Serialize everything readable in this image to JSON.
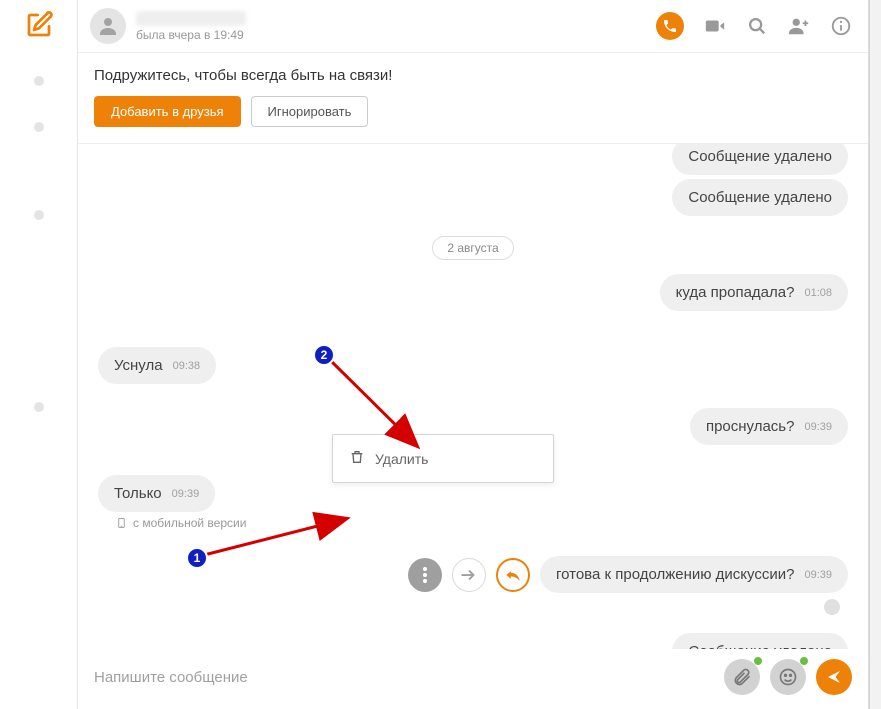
{
  "header": {
    "last_seen": "была вчера в 19:49"
  },
  "friend_bar": {
    "text": "Подружитесь, чтобы всегда быть на связи!",
    "add_friend": "Добавить в друзья",
    "ignore": "Игнорировать"
  },
  "date_separator": "2 августа",
  "messages": {
    "deleted1": "Сообщение удалено",
    "deleted2": "Сообщение удалено",
    "m1_text": "куда пропадала?",
    "m1_time": "01:08",
    "m2_text": "Уснула",
    "m2_time": "09:38",
    "m3_text": "проснулась?",
    "m3_time": "09:39",
    "m4_text": "Только",
    "m4_time": "09:39",
    "mobile_note": "с мобильной версии",
    "m5_text": "готова к продолжению дискуссии?",
    "m5_time": "09:39",
    "deleted3": "Сообщение удалено"
  },
  "popover": {
    "delete": "Удалить"
  },
  "composer": {
    "placeholder": "Напишите сообщение"
  },
  "annotations": {
    "n1": "1",
    "n2": "2"
  }
}
